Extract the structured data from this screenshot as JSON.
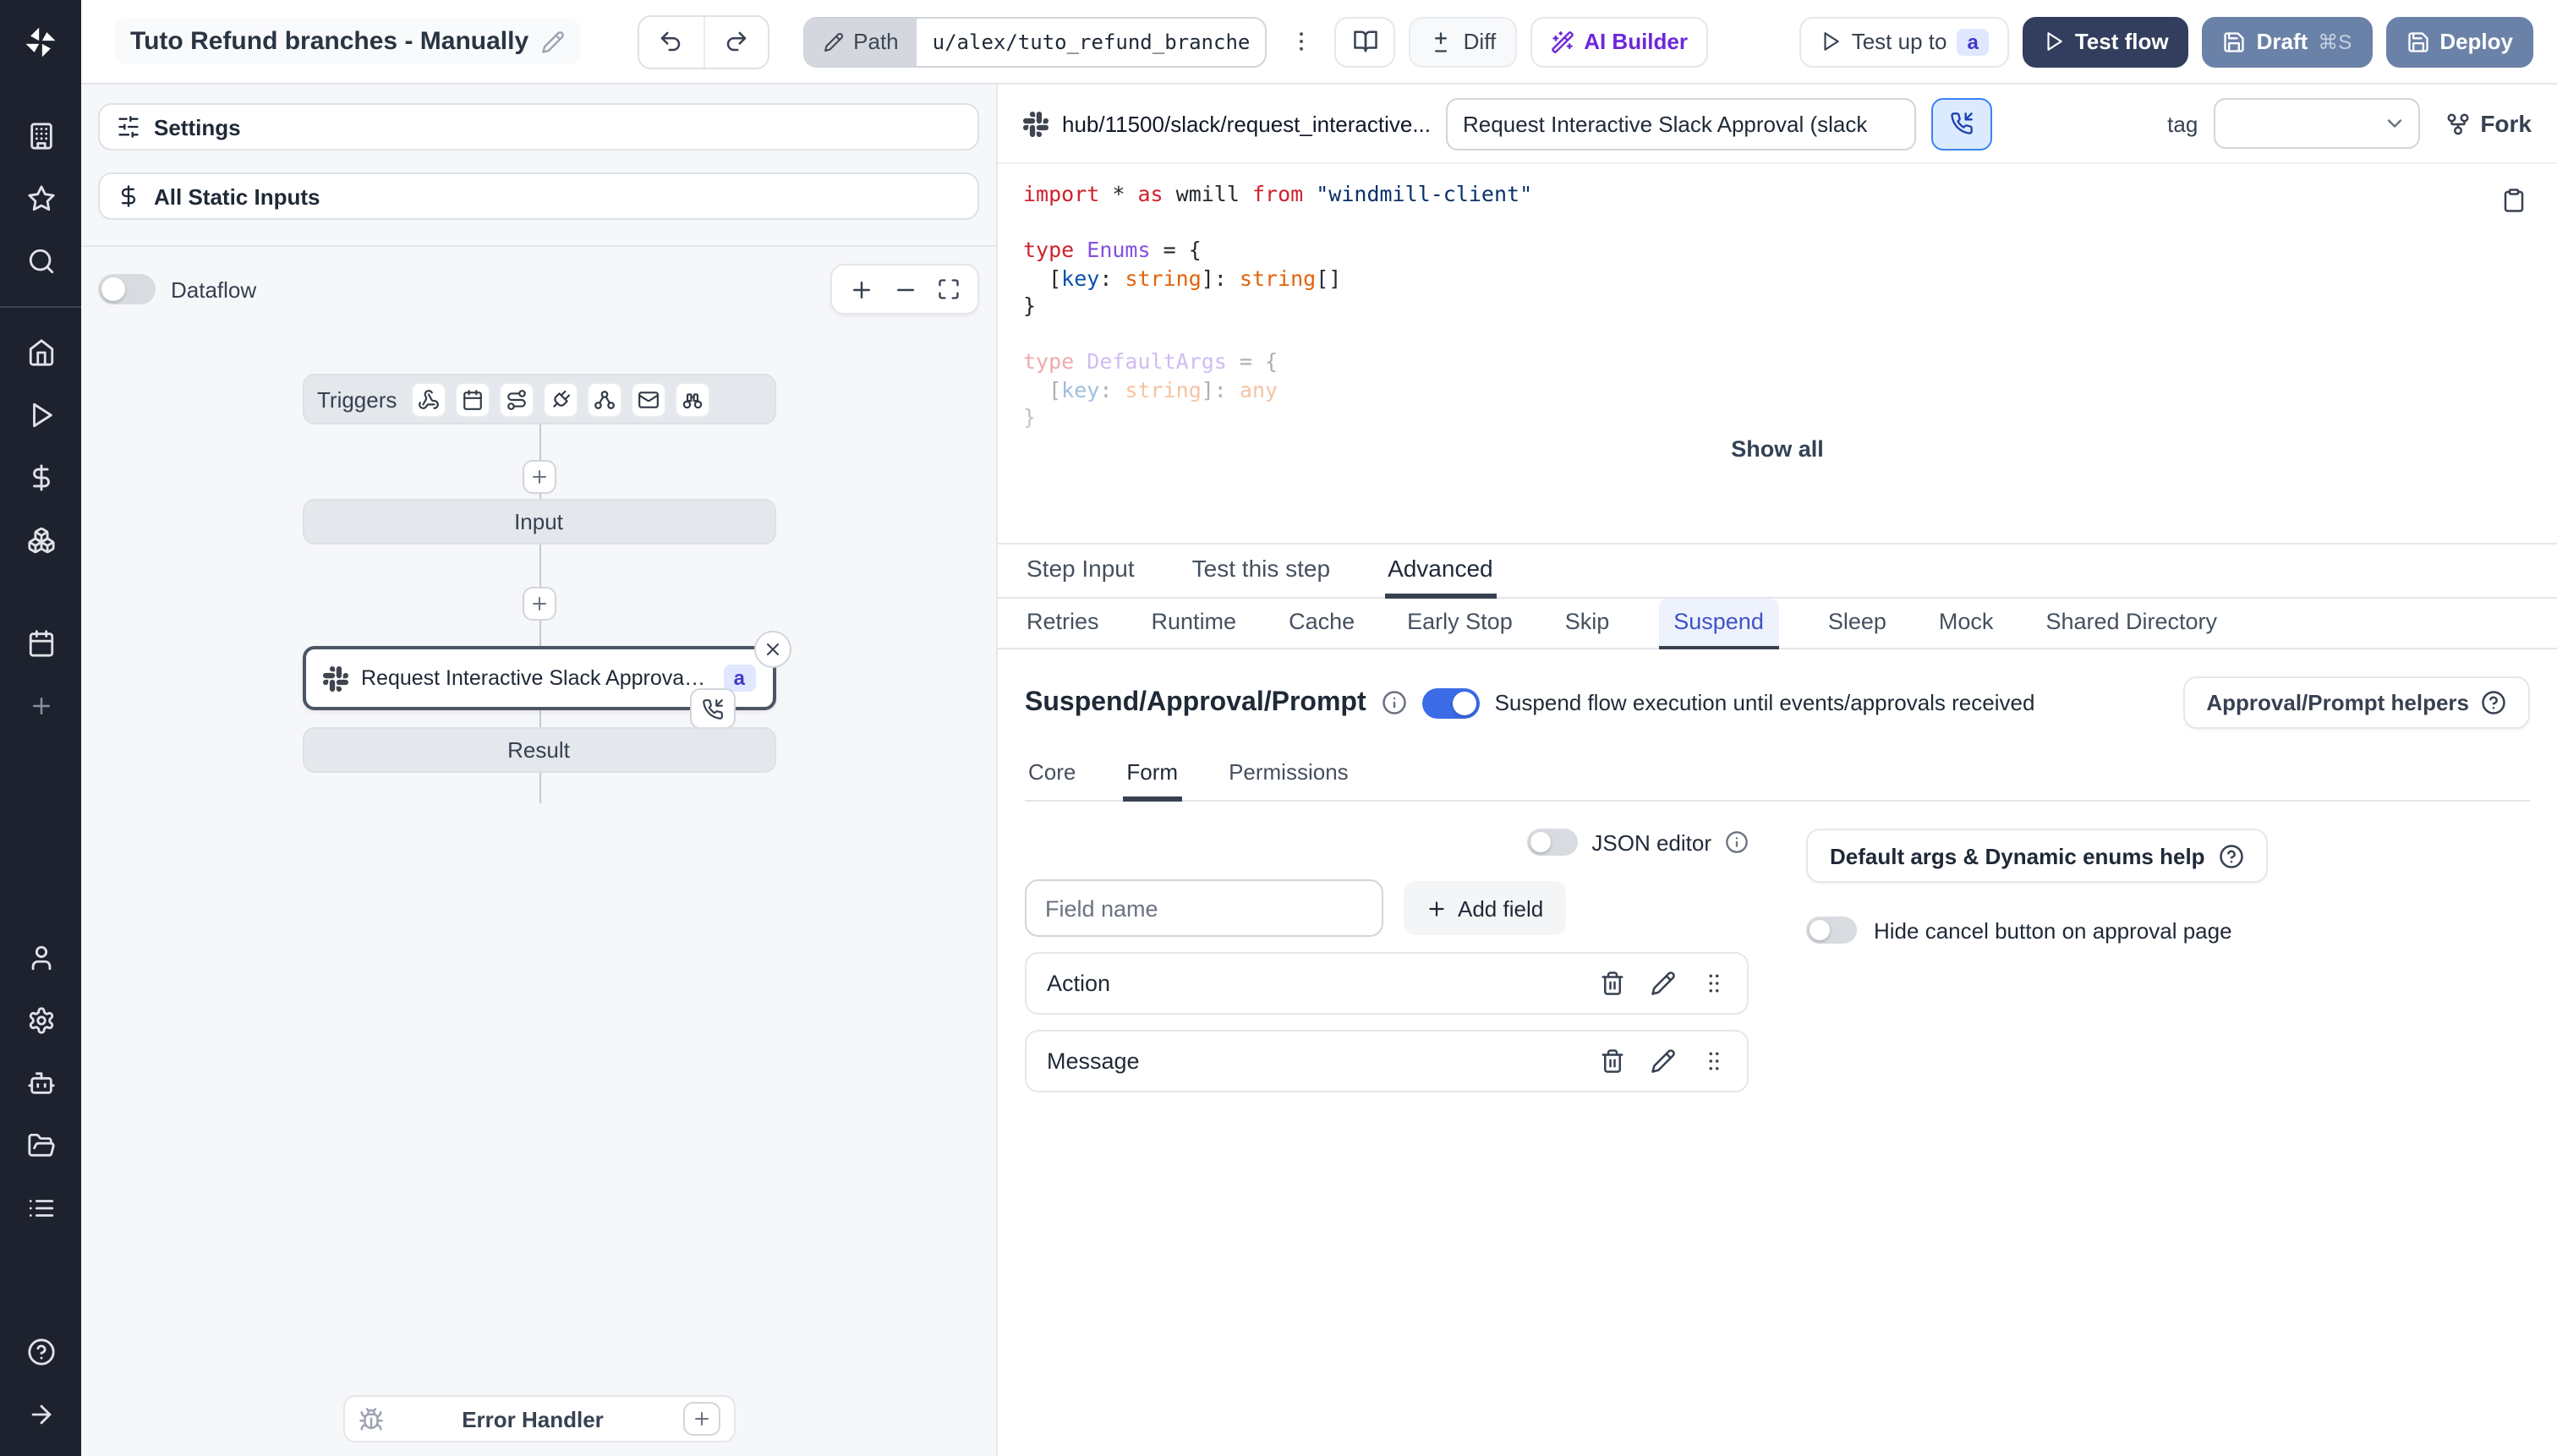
{
  "topbar": {
    "title": "Tuto Refund branches - Manually",
    "path_label": "Path",
    "path_value": "u/alex/tuto_refund_branches__",
    "diff_label": "Diff",
    "ai_builder_label": "AI Builder",
    "test_up_to_label": "Test up to",
    "test_up_to_badge": "a",
    "test_flow_label": "Test flow",
    "draft_label": "Draft",
    "draft_shortcut": "⌘S",
    "deploy_label": "Deploy"
  },
  "flow_panel": {
    "settings_label": "Settings",
    "static_inputs_label": "All Static Inputs",
    "dataflow_label": "Dataflow",
    "triggers_label": "Triggers",
    "input_label": "Input",
    "step_label": "Request Interactive Slack Approval (...",
    "step_badge": "a",
    "result_label": "Result",
    "error_handler_label": "Error Handler"
  },
  "editor": {
    "hub_path": "hub/11500/slack/request_interactive...",
    "step_name": "Request Interactive Slack Approval (slack",
    "tag_label": "tag",
    "fork_label": "Fork",
    "show_all_label": "Show all",
    "code_lines": [
      {
        "toks": [
          [
            "import",
            "k"
          ],
          [
            " * ",
            "p"
          ],
          [
            "as",
            "k"
          ],
          [
            " wmill ",
            "p"
          ],
          [
            "from",
            "k"
          ],
          [
            " ",
            "p"
          ],
          [
            "\"windmill-client\"",
            "s"
          ]
        ]
      },
      {
        "toks": []
      },
      {
        "toks": [
          [
            "type",
            "k"
          ],
          [
            " ",
            "p"
          ],
          [
            "Enums",
            "t"
          ],
          [
            " = {",
            "p"
          ]
        ]
      },
      {
        "toks": [
          [
            "  [",
            "p"
          ],
          [
            "key",
            "b"
          ],
          [
            ": ",
            "p"
          ],
          [
            "string",
            "o"
          ],
          [
            "]: ",
            "p"
          ],
          [
            "string",
            "o"
          ],
          [
            "[]",
            "p"
          ]
        ]
      },
      {
        "toks": [
          [
            "}",
            "p"
          ]
        ]
      },
      {
        "toks": []
      },
      {
        "faded": true,
        "toks": [
          [
            "type",
            "k"
          ],
          [
            " ",
            "p"
          ],
          [
            "DefaultArgs",
            "t"
          ],
          [
            " = {",
            "p"
          ]
        ]
      },
      {
        "faded": true,
        "toks": [
          [
            "  [",
            "p"
          ],
          [
            "key",
            "b"
          ],
          [
            ": ",
            "p"
          ],
          [
            "string",
            "o"
          ],
          [
            "]: ",
            "p"
          ],
          [
            "any",
            "o"
          ]
        ]
      },
      {
        "faded": true,
        "toks": [
          [
            "}",
            "p"
          ]
        ]
      }
    ]
  },
  "tabs": {
    "main": [
      "Step Input",
      "Test this step",
      "Advanced"
    ],
    "main_active": "Advanced",
    "sub": [
      "Retries",
      "Runtime",
      "Cache",
      "Early Stop",
      "Skip",
      "Suspend",
      "Sleep",
      "Mock",
      "Shared Directory"
    ],
    "sub_active": "Suspend"
  },
  "suspend": {
    "heading": "Suspend/Approval/Prompt",
    "toggle_state": "on",
    "toggle_label": "Suspend flow execution until events/approvals received",
    "helpers_label": "Approval/Prompt helpers",
    "inner_tabs": [
      "Core",
      "Form",
      "Permissions"
    ],
    "inner_active": "Form",
    "json_editor_label": "JSON editor",
    "json_editor_state": "off",
    "field_placeholder": "Field name",
    "add_field_label": "Add field",
    "fields": [
      "Action",
      "Message"
    ],
    "default_args_label": "Default args & Dynamic enums help",
    "hide_cancel_label": "Hide cancel button on approval page",
    "hide_cancel_state": "off"
  },
  "colors": {
    "sidebar_bg": "#1d222e",
    "accent_blue": "#3b6be6",
    "test_flow_bg": "#333e5e",
    "draft_deploy_bg": "#6b82a8",
    "ai_builder_purple": "#6d28d9",
    "badge_bg": "#e0e7ff",
    "badge_text": "#4338ca",
    "suspend_tab_text": "#3d53c6",
    "node_bar_bg": "#e4e8ec"
  }
}
